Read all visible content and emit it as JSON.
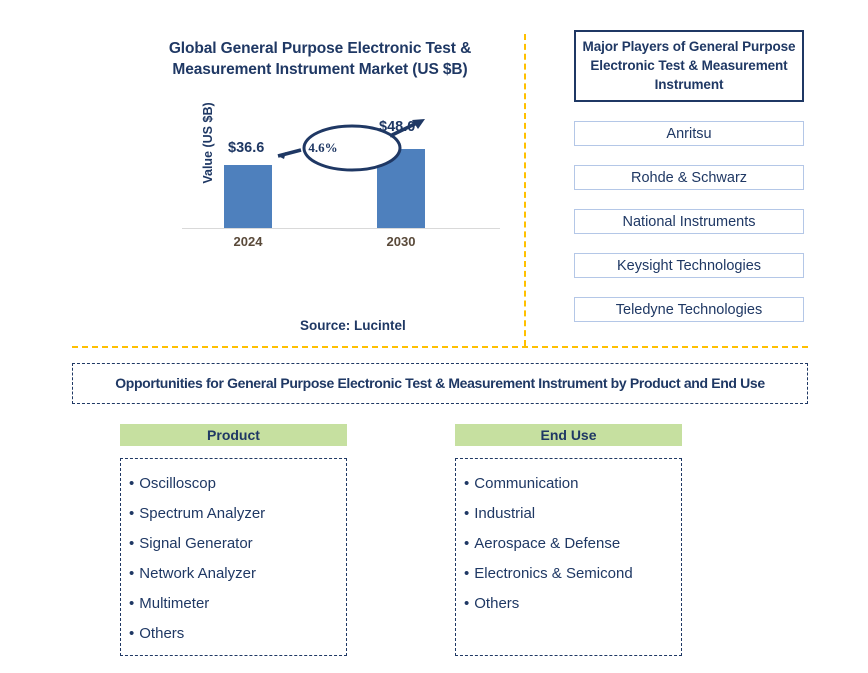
{
  "chart_panel": {
    "title": "Global General Purpose Electronic Test & Measurement Instrument Market (US $B)",
    "y_axis_label": "Value (US $B)",
    "source": "Source: Lucintel"
  },
  "chart_data": {
    "type": "bar",
    "title": "Global General Purpose Electronic Test & Measurement Instrument Market (US $B)",
    "categories": [
      "2024",
      "2030"
    ],
    "values": [
      36.6,
      48.0
    ],
    "value_labels": [
      "$36.6",
      "$48.0"
    ],
    "cagr": "4.6%",
    "xlabel": "",
    "ylabel": "Value (US $B)",
    "ylim": [
      0,
      55
    ],
    "grid": false,
    "legend": "none",
    "bar_color": "#4e80bd",
    "label_color": "#1f3864",
    "tick_color": "#5a4a3a"
  },
  "players": {
    "header": "Major Players of General Purpose Electronic Test & Measurement Instrument",
    "items": [
      "Anritsu",
      "Rohde & Schwarz",
      "National Instruments",
      "Keysight Technologies",
      "Teledyne Technologies"
    ]
  },
  "opportunities": {
    "banner": "Opportunities for General Purpose Electronic Test & Measurement Instrument by Product and End Use",
    "product": {
      "header": "Product",
      "items": [
        "Oscilloscop",
        "Spectrum Analyzer",
        "Signal Generator",
        "Network Analyzer",
        "Multimeter",
        "Others"
      ]
    },
    "end_use": {
      "header": "End Use",
      "items": [
        "Communication",
        "Industrial",
        "Aerospace & Defense",
        "Electronics & Semicond",
        "Others"
      ]
    }
  },
  "bullet_glyph": "•",
  "colors": {
    "navy": "#1f3864",
    "bar_blue": "#4e80bd",
    "divider_amber": "#ffc000",
    "header_green": "#c6e0a0",
    "box_border_light": "#b4c7e7"
  }
}
